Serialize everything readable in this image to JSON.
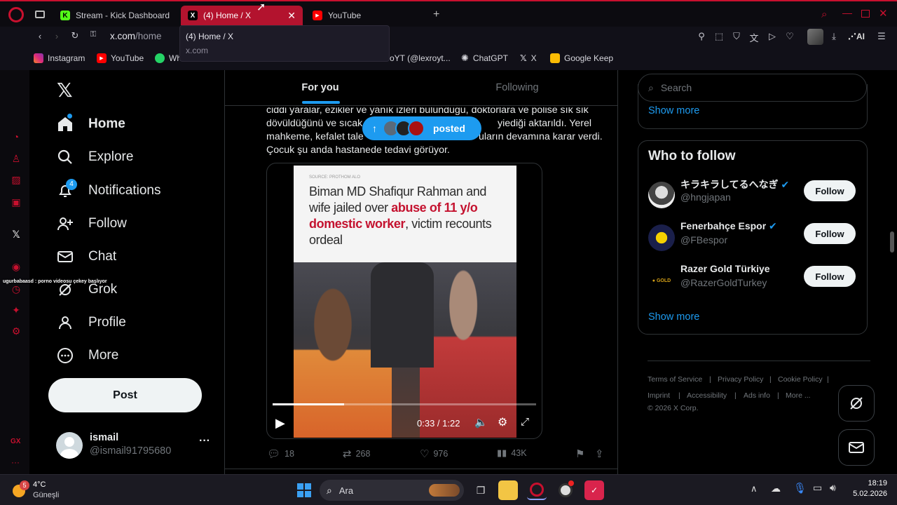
{
  "browser": {
    "tabs": [
      {
        "title": "Stream - Kick Dashboard",
        "favicon": "K"
      },
      {
        "title": "(4) Home / X",
        "favicon": "X"
      },
      {
        "title": "YouTube",
        "favicon": "▶"
      }
    ],
    "address": {
      "host": "x.com",
      "path": "/home"
    },
    "tooltip": {
      "title": "(4) Home / X",
      "url": "x.com"
    },
    "bookmarks": [
      "Instagram",
      "YouTube",
      "Wh",
      "oYT (@lexroyt...",
      "ChatGPT",
      "X",
      "Google Keep"
    ],
    "ai_label": "AI"
  },
  "overlay_text": "ugurbabaasd : porno videosu çekey başlıyor",
  "sidebar": {
    "items": [
      {
        "label": "Home",
        "icon": "home-icon"
      },
      {
        "label": "Explore",
        "icon": "search-icon"
      },
      {
        "label": "Notifications",
        "icon": "bell-icon",
        "badge": "4"
      },
      {
        "label": "Follow",
        "icon": "person-plus-icon"
      },
      {
        "label": "Chat",
        "icon": "mail-icon"
      },
      {
        "label": "Grok",
        "icon": "grok-icon"
      },
      {
        "label": "Profile",
        "icon": "person-icon"
      },
      {
        "label": "More",
        "icon": "more-circle-icon"
      }
    ],
    "post_label": "Post",
    "account": {
      "name": "ismail",
      "handle": "@ismail91795680"
    }
  },
  "timeline": {
    "tabs": [
      "For you",
      "Following"
    ],
    "text_lines": [
      "ciddi yaralar, ezikler ve yanık izleri bulunduğu, doktorlara ve polise sık sık",
      "dövüldüğünü ve sıcak",
      "yiediği aktarıldı. Yerel",
      "mahkeme, kefalet tale",
      "uların devamına karar verdi.",
      "Çocuk şu anda hastanede tedavi görüyor."
    ],
    "posted_pill": "posted",
    "media": {
      "source": "SOURCE: PROTHOM ALO",
      "headline_a": "Biman MD Shafiqur Rahman and wife jailed over ",
      "headline_red": "abuse of 11 y/o domestic worker",
      "headline_b": ", victim recounts ordeal",
      "time": "0:33 / 1:22",
      "progress": 0.27
    },
    "stats": {
      "replies": "18",
      "reposts": "268",
      "likes": "976",
      "views": "43K"
    }
  },
  "right": {
    "search_placeholder": "Search",
    "show_more_top": "Show more",
    "who_to_follow_title": "Who to follow",
    "follow_suggestions": [
      {
        "name": "キラキラしてるへなぎ",
        "handle": "@hngjapan",
        "verified": true,
        "button": "Follow"
      },
      {
        "name": "Fenerbahçe Espor",
        "handle": "@FBespor",
        "verified": true,
        "button": "Follow"
      },
      {
        "name": "Razer Gold Türkiye",
        "handle": "@RazerGoldTurkey",
        "verified": false,
        "button": "Follow"
      }
    ],
    "show_more": "Show more",
    "footer": [
      "Terms of Service",
      "Privacy Policy",
      "Cookie Policy",
      "Imprint",
      "Accessibility",
      "Ads info",
      "More ...",
      "© 2026 X Corp."
    ]
  },
  "taskbar": {
    "weather_temp": "4°C",
    "weather_desc": "Güneşli",
    "weather_badge": "5",
    "search_label": "Ara",
    "time": "18:19",
    "date": "5.02.2026"
  },
  "colors": {
    "accent_red": "#c8102e",
    "x_blue": "#1d9bf0",
    "headline_red": "#c4122f"
  }
}
